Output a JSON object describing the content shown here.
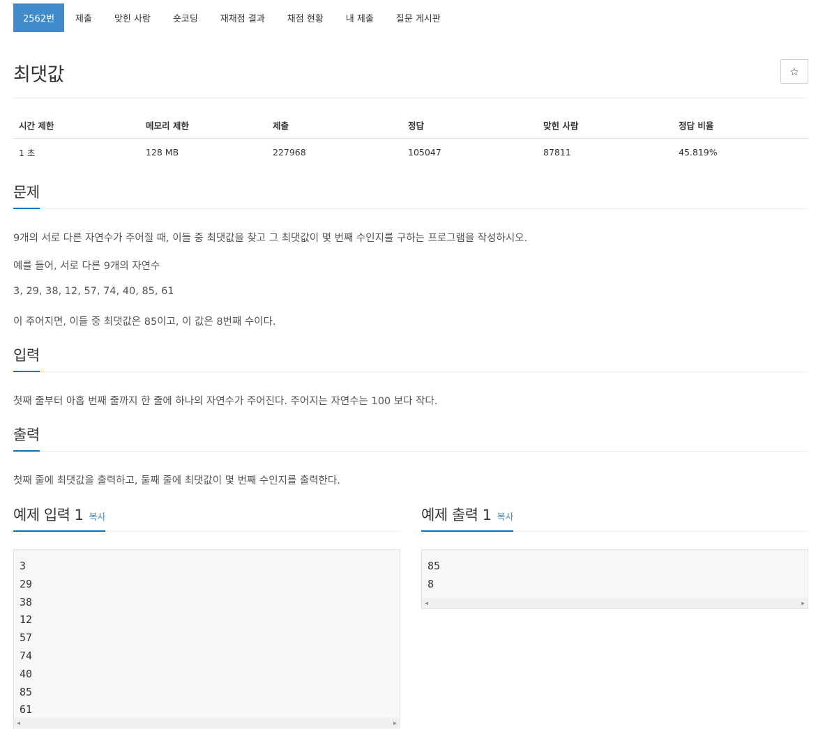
{
  "nav": {
    "items": [
      "2562번",
      "제출",
      "맞힌 사람",
      "숏코딩",
      "재채점 결과",
      "채점 현황",
      "내 제출",
      "질문 게시판"
    ]
  },
  "problem": {
    "title": "최댓값",
    "star_icon": "☆"
  },
  "info_table": {
    "headers": [
      "시간 제한",
      "메모리 제한",
      "제출",
      "정답",
      "맞힌 사람",
      "정답 비율"
    ],
    "values": [
      "1 초",
      "128 MB",
      "227968",
      "105047",
      "87811",
      "45.819%"
    ]
  },
  "sections": {
    "problem_label": "문제",
    "problem_lines": [
      "9개의 서로 다른 자연수가 주어질 때, 이들 중 최댓값을 찾고 그 최댓값이 몇 번째 수인지를 구하는 프로그램을 작성하시오.",
      "예를 들어, 서로 다른 9개의 자연수",
      "3, 29, 38, 12, 57, 74, 40, 85, 61",
      "이 주어지면, 이들 중 최댓값은 85이고, 이 값은 8번째 수이다."
    ],
    "input_label": "입력",
    "input_text": "첫째 줄부터 아홉 번째 줄까지 한 줄에 하나의 자연수가 주어진다. 주어지는 자연수는 100 보다 작다.",
    "output_label": "출력",
    "output_text": "첫째 줄에 최댓값을 출력하고, 둘째 줄에 최댓값이 몇 번째 수인지를 출력한다."
  },
  "samples": {
    "input_label": "예제 입력 1",
    "output_label": "예제 출력 1",
    "copy_label": "복사",
    "input_lines": [
      "3",
      "29",
      "38",
      "12",
      "57",
      "74",
      "40",
      "85",
      "61"
    ],
    "output_lines": [
      "85",
      "8"
    ]
  },
  "colors": {
    "accent": "#428bca",
    "section_underline": "#0076c0"
  }
}
